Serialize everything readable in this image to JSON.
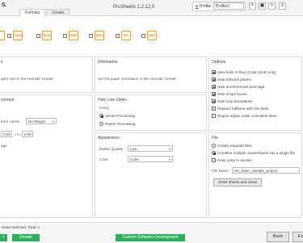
{
  "app": {
    "logo": "S.",
    "window_title": "ProSheets 1.2.12.0",
    "tabs": [
      {
        "label": "Formats"
      },
      {
        "label": "Create"
      }
    ]
  },
  "profile": {
    "label": "Profile",
    "selected": "Profile2",
    "add": "+",
    "save": "▣",
    "delete": "×",
    "more": "≡"
  },
  "formats": [
    {
      "label": "DWG"
    },
    {
      "label": "DGN"
    },
    {
      "label": "DWF"
    },
    {
      "label": "NWC"
    },
    {
      "label": "IFC"
    },
    {
      "label": "IMG"
    }
  ],
  "paper_size": {
    "title": "e",
    "hint": "aper size in the next tab 'Create'"
  },
  "orientation": {
    "title": "Orientation",
    "hint": "Set the paper orientation in the next tab 'Create'"
  },
  "placement": {
    "title": "cement",
    "offset_label": "from corner",
    "margin_select": "No Margin",
    "y_label": "=Y=",
    "x_value": "0.00",
    "y_value": "0.00"
  },
  "zoom": {
    "label": "age"
  },
  "hidden_line_views": {
    "title": "Hide Line Views",
    "using": "Using",
    "vector": "Vector Processing",
    "raster": "Raster Processing"
  },
  "appearance": {
    "title": "Appearance",
    "raster_quality_label": "Raster Quality",
    "raster_quality_value": "Low",
    "color_label": "Color",
    "color_value": "Color"
  },
  "options": {
    "title": "Options",
    "items": [
      {
        "label": "View links in blue (Color prints only)"
      },
      {
        "label": "Hide ref/work planes"
      },
      {
        "label": "Hide unreferenced view tags"
      },
      {
        "label": "Hide scope boxes"
      },
      {
        "label": "Hide crop boundaries"
      },
      {
        "label": "Replace halftone with thin lines"
      },
      {
        "label": "Region edges mask coincident lines"
      }
    ]
  },
  "file": {
    "title": "File",
    "separate": "Create separate files",
    "combine": "Combine multiple views/sheets into a single file",
    "keep": "Keep jump to section",
    "name_label": "File Name",
    "name_value": "rac_basic_sample_project",
    "order_button": "Order sheets and views"
  },
  "status": {
    "text": "views selected. Total: 1",
    "left_button": "t",
    "donate": "Donate",
    "custom_dev": "Custom Software Development",
    "back": "Back",
    "next": "Ex"
  },
  "colors": {
    "accent_green": "#2fae5d",
    "format_orange": "#e59a2c"
  }
}
